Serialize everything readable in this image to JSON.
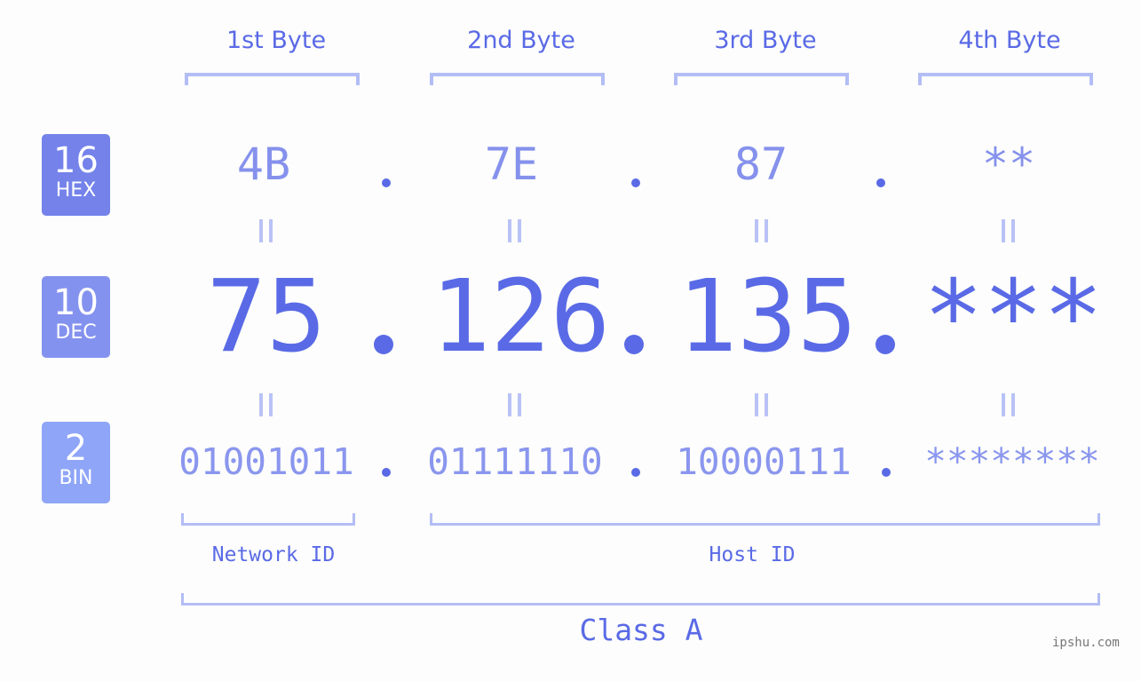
{
  "header": {
    "bytes": [
      "1st Byte",
      "2nd Byte",
      "3rd Byte",
      "4th Byte"
    ]
  },
  "badges": [
    {
      "num": "16",
      "unit": "HEX",
      "color": "#7482ea"
    },
    {
      "num": "10",
      "unit": "DEC",
      "color": "#8492ef"
    },
    {
      "num": "2",
      "unit": "BIN",
      "color": "#8fa5f8"
    }
  ],
  "hex": [
    "4B",
    "7E",
    "87",
    "**"
  ],
  "dec": [
    "75",
    "126",
    "135",
    "***"
  ],
  "bin": [
    "01001011",
    "01111110",
    "10000111",
    "********"
  ],
  "separator": ".",
  "labels": {
    "network_id": "Network ID",
    "host_id": "Host ID",
    "class": "Class A"
  },
  "watermark": "ipshu.com",
  "colors": {
    "accent": "#5a6ae6",
    "bracket": "#b3bdf5",
    "background": "#fcfdfc"
  }
}
